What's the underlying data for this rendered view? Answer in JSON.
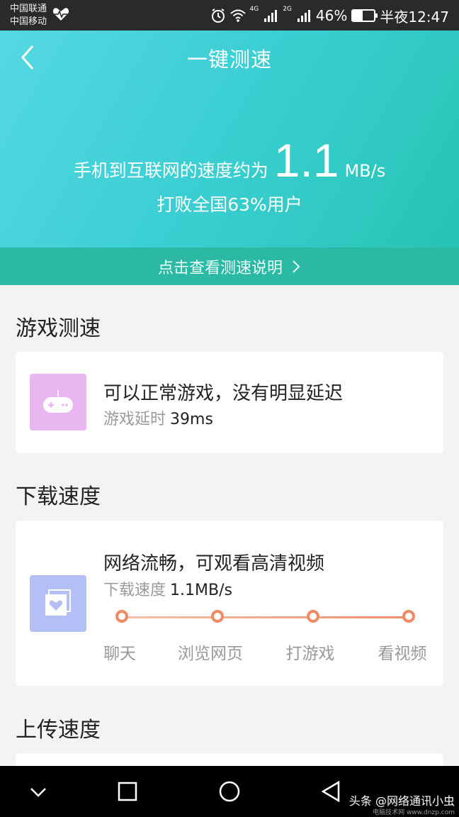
{
  "status_bar": {
    "carrier1": "中国联通",
    "carrier2": "中国移动",
    "network1": "4G",
    "network2": "2G",
    "battery": "46%",
    "battery_level": 0.46,
    "time": "半夜12:47"
  },
  "header": {
    "title": "一键测速",
    "speed_prefix": "手机到互联网的速度约为",
    "speed_value": "1.1",
    "speed_unit": "MB/s",
    "beat_text": "打败全国63%用户",
    "explain_link": "点击查看测速说明"
  },
  "game": {
    "section_title": "游戏测速",
    "main_text": "可以正常游戏，没有明显延迟",
    "latency_label": "游戏延时",
    "latency_value": "39ms",
    "icon_color": "#e9b6f2"
  },
  "download": {
    "section_title": "下载速度",
    "main_text": "网络流畅，可观看高清视频",
    "speed_label": "下载速度",
    "speed_value": "1.1MB/s",
    "icon_color": "#b3bff5",
    "levels": [
      "聊天",
      "浏览网页",
      "打游戏",
      "看视频"
    ]
  },
  "upload": {
    "section_title": "上传速度"
  },
  "watermark": {
    "text": "头条 @网络通讯小虫",
    "site": "电脑技术网 www.dnzp.com"
  },
  "colors": {
    "header_gradient_start": "#55d8e2",
    "header_gradient_end": "#26c4b4",
    "explain_bar": "#2cb9a3",
    "track_dot": "#f08a62"
  }
}
